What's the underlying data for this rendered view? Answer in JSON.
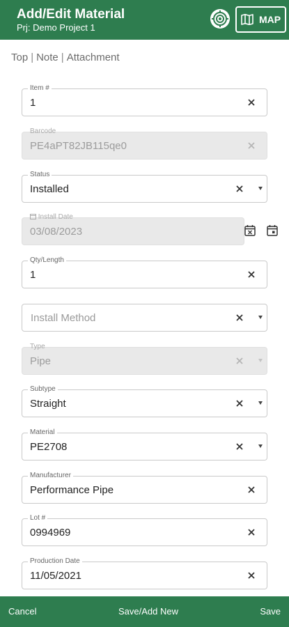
{
  "header": {
    "title": "Add/Edit Material",
    "subtitle": "Prj: Demo Project 1",
    "map_label": "MAP",
    "icons": {
      "locate": "crosshair-target-icon",
      "map": "map-icon"
    }
  },
  "tabs": {
    "top": "Top",
    "sep1": "|",
    "note": "Note",
    "sep2": "|",
    "attachment": "Attachment"
  },
  "fields": {
    "item": {
      "label": "Item #",
      "value": "1"
    },
    "barcode": {
      "label": "Barcode",
      "value": "PE4aPT82JB115qe0"
    },
    "status": {
      "label": "Status",
      "value": "Installed"
    },
    "install_date": {
      "label": "Install Date",
      "value": "03/08/2023"
    },
    "qty": {
      "label": "Qty/Length",
      "value": "1"
    },
    "install_method": {
      "placeholder": "Install Method"
    },
    "type": {
      "label": "Type",
      "value": "Pipe"
    },
    "subtype": {
      "label": "Subtype",
      "value": "Straight"
    },
    "material": {
      "label": "Material",
      "value": "PE2708"
    },
    "manufacturer": {
      "label": "Manufacturer",
      "value": "Performance Pipe"
    },
    "lot": {
      "label": "Lot #",
      "value": "0994969"
    },
    "production_date": {
      "label": "Production Date",
      "value": "11/05/2021"
    }
  },
  "footer": {
    "cancel": "Cancel",
    "save_add_new": "Save/Add New",
    "save": "Save"
  },
  "colors": {
    "brand": "#2e7d4f",
    "disabled_bg": "#e9e9e9",
    "border": "#c9c9c9"
  }
}
